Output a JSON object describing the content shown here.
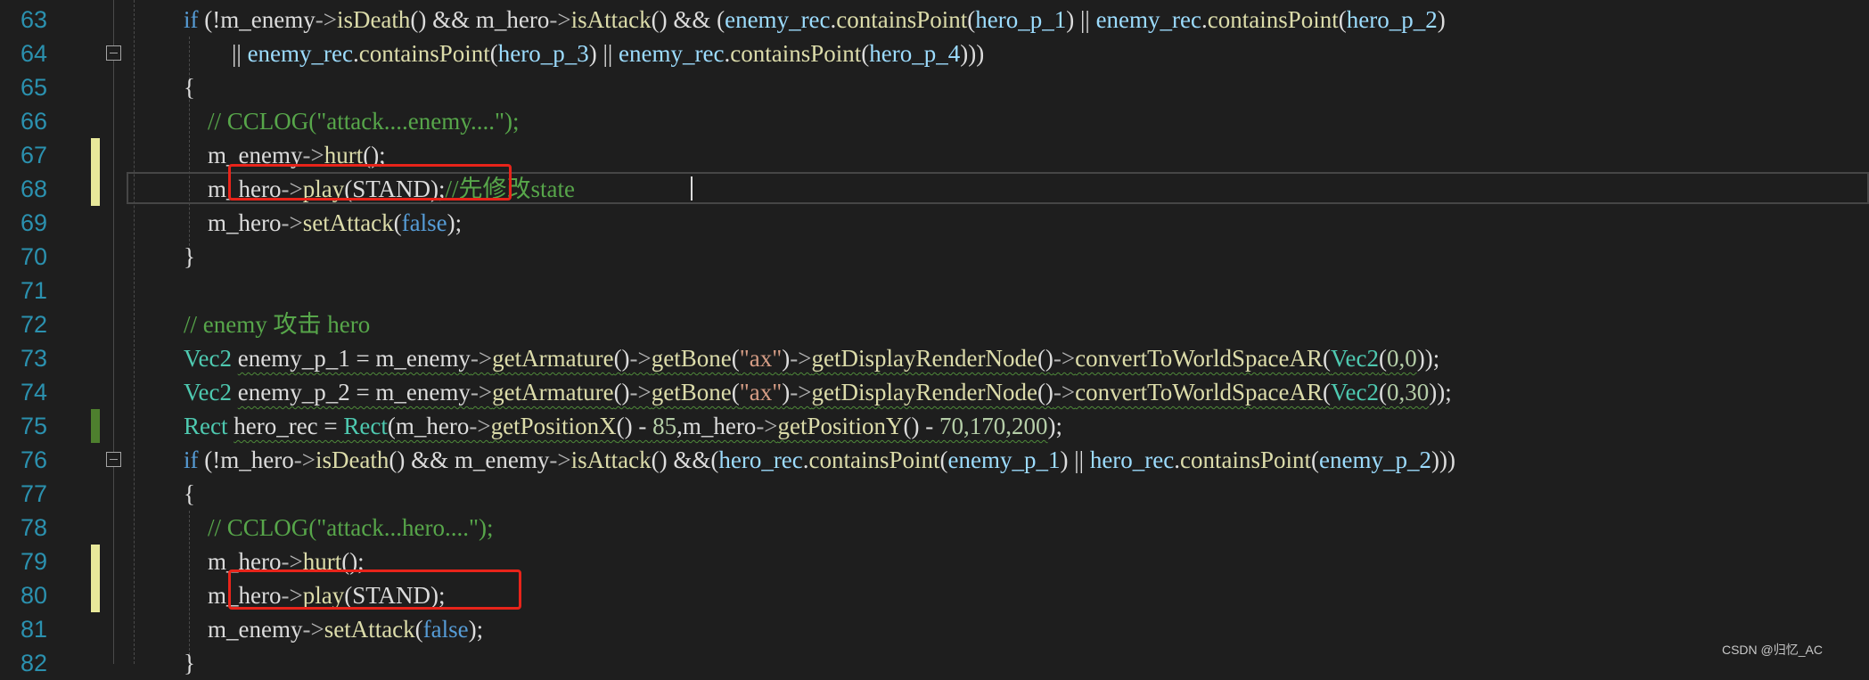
{
  "editor": {
    "colors": {
      "background": "#1e1e1e",
      "line_number": "#2b91af",
      "keyword": "#569cd6",
      "function": "#dcdcaa",
      "type": "#4ec9b0",
      "variable": "#9cdcfe",
      "comment": "#57a64a",
      "string": "#d69d85",
      "number": "#b5cea8",
      "highlight_box": "#e8241a",
      "change_marker_saved": "#4e7f2e",
      "change_marker_unsaved": "#e8e89a"
    },
    "lines": [
      {
        "num": "63",
        "marker": "",
        "fold": false,
        "tokens": [
          {
            "t": "if",
            "c": "kw"
          },
          {
            "t": " (!",
            "c": "pl"
          },
          {
            "t": "m_enemy",
            "c": "id"
          },
          {
            "t": "->",
            "c": "op"
          },
          {
            "t": "isDeath",
            "c": "fn"
          },
          {
            "t": "() && ",
            "c": "pl"
          },
          {
            "t": "m_hero",
            "c": "id"
          },
          {
            "t": "->",
            "c": "op"
          },
          {
            "t": "isAttack",
            "c": "fn"
          },
          {
            "t": "() && (",
            "c": "pl"
          },
          {
            "t": "enemy_rec",
            "c": "var"
          },
          {
            "t": ".",
            "c": "pl"
          },
          {
            "t": "containsPoint",
            "c": "fn"
          },
          {
            "t": "(",
            "c": "pl"
          },
          {
            "t": "hero_p_1",
            "c": "var"
          },
          {
            "t": ") || ",
            "c": "pl"
          },
          {
            "t": "enemy_rec",
            "c": "var"
          },
          {
            "t": ".",
            "c": "pl"
          },
          {
            "t": "containsPoint",
            "c": "fn"
          },
          {
            "t": "(",
            "c": "pl"
          },
          {
            "t": "hero_p_2",
            "c": "var"
          },
          {
            "t": ")",
            "c": "pl"
          }
        ]
      },
      {
        "num": "64",
        "marker": "",
        "fold": true,
        "tokens": [
          {
            "t": "        || ",
            "c": "pl"
          },
          {
            "t": "enemy_rec",
            "c": "var"
          },
          {
            "t": ".",
            "c": "pl"
          },
          {
            "t": "containsPoint",
            "c": "fn"
          },
          {
            "t": "(",
            "c": "pl"
          },
          {
            "t": "hero_p_3",
            "c": "var"
          },
          {
            "t": ") || ",
            "c": "pl"
          },
          {
            "t": "enemy_rec",
            "c": "var"
          },
          {
            "t": ".",
            "c": "pl"
          },
          {
            "t": "containsPoint",
            "c": "fn"
          },
          {
            "t": "(",
            "c": "pl"
          },
          {
            "t": "hero_p_4",
            "c": "var"
          },
          {
            "t": ")))",
            "c": "pl"
          }
        ]
      },
      {
        "num": "65",
        "marker": "",
        "fold": false,
        "tokens": [
          {
            "t": "{",
            "c": "pl"
          }
        ]
      },
      {
        "num": "66",
        "marker": "",
        "fold": false,
        "tokens": [
          {
            "t": "    // CCLOG(\"attack....enemy....\");",
            "c": "cm"
          }
        ]
      },
      {
        "num": "67",
        "marker": "unsaved",
        "fold": false,
        "tokens": [
          {
            "t": "    m_enemy",
            "c": "id"
          },
          {
            "t": "->",
            "c": "op"
          },
          {
            "t": "hurt",
            "c": "fn"
          },
          {
            "t": "();",
            "c": "pl"
          }
        ]
      },
      {
        "num": "68",
        "marker": "unsaved",
        "fold": false,
        "tokens": [
          {
            "t": "    m_hero",
            "c": "id"
          },
          {
            "t": "->",
            "c": "op"
          },
          {
            "t": "play",
            "c": "fn"
          },
          {
            "t": "(STAND);",
            "c": "pl"
          },
          {
            "t": "//先修改state",
            "c": "cm"
          }
        ]
      },
      {
        "num": "69",
        "marker": "",
        "fold": false,
        "tokens": [
          {
            "t": "    m_hero",
            "c": "id"
          },
          {
            "t": "->",
            "c": "op"
          },
          {
            "t": "setAttack",
            "c": "fn"
          },
          {
            "t": "(",
            "c": "pl"
          },
          {
            "t": "false",
            "c": "kw"
          },
          {
            "t": ");",
            "c": "pl"
          }
        ]
      },
      {
        "num": "70",
        "marker": "",
        "fold": false,
        "tokens": [
          {
            "t": "}",
            "c": "pl"
          }
        ]
      },
      {
        "num": "71",
        "marker": "",
        "fold": false,
        "tokens": []
      },
      {
        "num": "72",
        "marker": "",
        "fold": false,
        "tokens": [
          {
            "t": "// enemy 攻击 hero",
            "c": "cm"
          }
        ]
      },
      {
        "num": "73",
        "marker": "",
        "fold": false,
        "tokens": [
          {
            "t": "Vec2",
            "c": "type"
          },
          {
            "t": " ",
            "c": "pl"
          },
          {
            "t": "enemy_p_1 = m_enemy",
            "c": "id",
            "sq": true
          },
          {
            "t": "->",
            "c": "op",
            "sq": true
          },
          {
            "t": "getArmature",
            "c": "fn",
            "sq": true
          },
          {
            "t": "()",
            "c": "pl",
            "sq": true
          },
          {
            "t": "->",
            "c": "op",
            "sq": true
          },
          {
            "t": "getBone",
            "c": "fn",
            "sq": true
          },
          {
            "t": "(",
            "c": "pl",
            "sq": true
          },
          {
            "t": "\"ax\"",
            "c": "str",
            "sq": true
          },
          {
            "t": ")",
            "c": "pl",
            "sq": true
          },
          {
            "t": "->",
            "c": "op",
            "sq": true
          },
          {
            "t": "getDisplayRenderNode",
            "c": "fn",
            "sq": true
          },
          {
            "t": "()",
            "c": "pl",
            "sq": true
          },
          {
            "t": "->",
            "c": "op",
            "sq": true
          },
          {
            "t": "convertToWorldSpaceAR",
            "c": "fn",
            "sq": true
          },
          {
            "t": "(",
            "c": "pl",
            "sq": true
          },
          {
            "t": "Vec2",
            "c": "type",
            "sq": true
          },
          {
            "t": "(",
            "c": "pl",
            "sq": true
          },
          {
            "t": "0,0",
            "c": "num",
            "sq": true
          },
          {
            "t": "));",
            "c": "pl"
          }
        ]
      },
      {
        "num": "74",
        "marker": "",
        "fold": false,
        "tokens": [
          {
            "t": "Vec2",
            "c": "type"
          },
          {
            "t": " ",
            "c": "pl"
          },
          {
            "t": "enemy_p_2 = m_enemy",
            "c": "id",
            "sq": true
          },
          {
            "t": "->",
            "c": "op",
            "sq": true
          },
          {
            "t": "getArmature",
            "c": "fn",
            "sq": true
          },
          {
            "t": "()",
            "c": "pl",
            "sq": true
          },
          {
            "t": "->",
            "c": "op",
            "sq": true
          },
          {
            "t": "getBone",
            "c": "fn",
            "sq": true
          },
          {
            "t": "(",
            "c": "pl",
            "sq": true
          },
          {
            "t": "\"ax\"",
            "c": "str",
            "sq": true
          },
          {
            "t": ")",
            "c": "pl",
            "sq": true
          },
          {
            "t": "->",
            "c": "op",
            "sq": true
          },
          {
            "t": "getDisplayRenderNode",
            "c": "fn",
            "sq": true
          },
          {
            "t": "()",
            "c": "pl",
            "sq": true
          },
          {
            "t": "->",
            "c": "op",
            "sq": true
          },
          {
            "t": "convertToWorldSpaceAR",
            "c": "fn",
            "sq": true
          },
          {
            "t": "(",
            "c": "pl",
            "sq": true
          },
          {
            "t": "Vec2",
            "c": "type",
            "sq": true
          },
          {
            "t": "(",
            "c": "pl",
            "sq": true
          },
          {
            "t": "0,30",
            "c": "num",
            "sq": true
          },
          {
            "t": "));",
            "c": "pl"
          }
        ]
      },
      {
        "num": "75",
        "marker": "saved",
        "fold": false,
        "tokens": [
          {
            "t": "Rect",
            "c": "type"
          },
          {
            "t": " ",
            "c": "pl"
          },
          {
            "t": "hero_rec = ",
            "c": "id",
            "sq": true
          },
          {
            "t": "Rect",
            "c": "type",
            "sq": true
          },
          {
            "t": "(m_hero",
            "c": "id",
            "sq": true
          },
          {
            "t": "->",
            "c": "op",
            "sq": true
          },
          {
            "t": "getPositionX",
            "c": "fn",
            "sq": true
          },
          {
            "t": "() - ",
            "c": "pl",
            "sq": true
          },
          {
            "t": "85",
            "c": "num",
            "sq": true
          },
          {
            "t": ",m_hero",
            "c": "id",
            "sq": true
          },
          {
            "t": "->",
            "c": "op",
            "sq": true
          },
          {
            "t": "getPositionY",
            "c": "fn",
            "sq": true
          },
          {
            "t": "() - ",
            "c": "pl",
            "sq": true
          },
          {
            "t": "70,170,200",
            "c": "num",
            "sq": true
          },
          {
            "t": ");",
            "c": "pl"
          }
        ]
      },
      {
        "num": "76",
        "marker": "",
        "fold": true,
        "tokens": [
          {
            "t": "if",
            "c": "kw"
          },
          {
            "t": " (!",
            "c": "pl"
          },
          {
            "t": "m_hero",
            "c": "id"
          },
          {
            "t": "->",
            "c": "op"
          },
          {
            "t": "isDeath",
            "c": "fn"
          },
          {
            "t": "() && ",
            "c": "pl"
          },
          {
            "t": "m_enemy",
            "c": "id"
          },
          {
            "t": "->",
            "c": "op"
          },
          {
            "t": "isAttack",
            "c": "fn"
          },
          {
            "t": "() &&(",
            "c": "pl"
          },
          {
            "t": "hero_rec",
            "c": "var"
          },
          {
            "t": ".",
            "c": "pl"
          },
          {
            "t": "containsPoint",
            "c": "fn"
          },
          {
            "t": "(",
            "c": "pl"
          },
          {
            "t": "enemy_p_1",
            "c": "var"
          },
          {
            "t": ") || ",
            "c": "pl"
          },
          {
            "t": "hero_rec",
            "c": "var"
          },
          {
            "t": ".",
            "c": "pl"
          },
          {
            "t": "containsPoint",
            "c": "fn"
          },
          {
            "t": "(",
            "c": "pl"
          },
          {
            "t": "enemy_p_2",
            "c": "var"
          },
          {
            "t": ")))",
            "c": "pl"
          }
        ]
      },
      {
        "num": "77",
        "marker": "",
        "fold": false,
        "tokens": [
          {
            "t": "{",
            "c": "pl"
          }
        ]
      },
      {
        "num": "78",
        "marker": "",
        "fold": false,
        "tokens": [
          {
            "t": "    // CCLOG(\"attack...hero....\");",
            "c": "cm"
          }
        ]
      },
      {
        "num": "79",
        "marker": "unsaved",
        "fold": false,
        "tokens": [
          {
            "t": "    m_hero",
            "c": "id"
          },
          {
            "t": "->",
            "c": "op"
          },
          {
            "t": "hurt",
            "c": "fn"
          },
          {
            "t": "();",
            "c": "pl"
          }
        ]
      },
      {
        "num": "80",
        "marker": "unsaved",
        "fold": false,
        "tokens": [
          {
            "t": "    m_hero",
            "c": "id"
          },
          {
            "t": "->",
            "c": "op"
          },
          {
            "t": "play",
            "c": "fn"
          },
          {
            "t": "(STAND);",
            "c": "pl"
          }
        ]
      },
      {
        "num": "81",
        "marker": "",
        "fold": false,
        "tokens": [
          {
            "t": "    m_enemy",
            "c": "id"
          },
          {
            "t": "->",
            "c": "op"
          },
          {
            "t": "setAttack",
            "c": "fn"
          },
          {
            "t": "(",
            "c": "pl"
          },
          {
            "t": "false",
            "c": "kw"
          },
          {
            "t": ");",
            "c": "pl"
          }
        ]
      },
      {
        "num": "82",
        "marker": "",
        "fold": false,
        "tokens": [
          {
            "t": "}",
            "c": "pl"
          }
        ]
      }
    ]
  },
  "watermark": "CSDN @归忆_AC"
}
